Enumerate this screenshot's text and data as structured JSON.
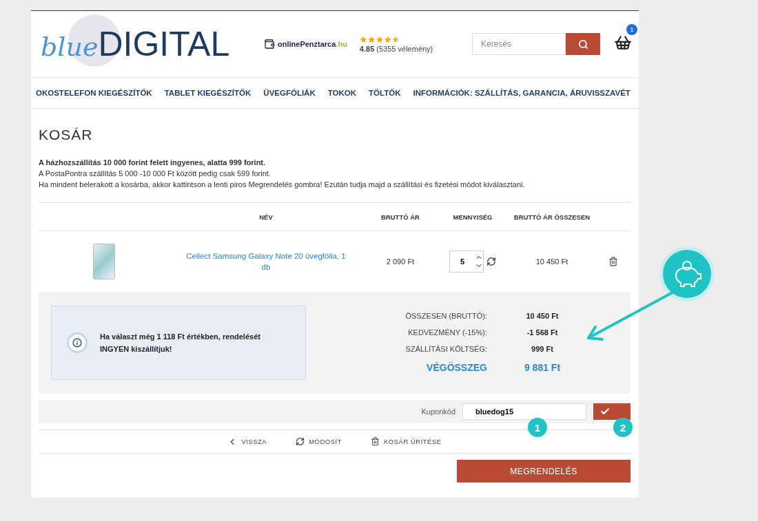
{
  "header": {
    "logo": {
      "part_1": "blue",
      "part_2": "DIGITAL"
    },
    "partner": {
      "name": "onlinePenztarca",
      "domain": ".hu"
    },
    "rating": {
      "stars": 4.5,
      "score": "4.85",
      "reviews": "(5355 vélemény)"
    },
    "search": {
      "placeholder": "Keresés"
    },
    "cart_count": "1"
  },
  "nav": [
    "OKOSTELEFON KIEGÉSZÍTŐK",
    "TABLET KIEGÉSZÍTŐK",
    "ÜVEGFÓLIÁK",
    "TOKOK",
    "TÖLTŐK",
    "INFORMÁCIÓK: SZÁLLÍTÁS, GARANCIA, ÁRUVISSZAVÉT"
  ],
  "page_title": "KOSÁR",
  "info": [
    "A házhozszállítás 10 000 forint felett ingyenes, alatta 999 forint.",
    "A PostaPontra szállítás 5 000 -10 000 Ft között pedig csak 599 forint.",
    "Ha mindent belerakott a kosárba, akkor kattintson a lenti piros Megrendelés gombra! Ezután tudja majd a szállítási és fizetési módot kiválasztani."
  ],
  "table": {
    "columns": [
      "NÉV",
      "BRUTTÓ ÁR",
      "MENNYISÉG",
      "BRUTTÓ ÁR ÖSSZESEN"
    ],
    "rows": [
      {
        "name": "Cellect Samsung Galaxy Note 20 üvegfólia, 1 db",
        "price": "2 090 Ft",
        "quantity": "5",
        "total": "10 450 Ft"
      }
    ]
  },
  "notice": "Ha választ még 1 118 Ft értékben, rendelését INGYEN kiszállítjuk!",
  "summary": [
    {
      "label": "ÖSSZESEN (BRUTTÓ):",
      "value": "10 450 Ft",
      "kind": "normal"
    },
    {
      "label": "KEDVEZMÉNY (-15%):",
      "value": "-1 568 Ft",
      "kind": "normal"
    },
    {
      "label": "SZÁLLÍTÁSI KÖLTSÉG:",
      "value": "999 Ft",
      "kind": "normal"
    },
    {
      "label": "VÉGÖSSZEG",
      "value": "9 881 Ft",
      "kind": "total"
    }
  ],
  "coupon": {
    "label": "Kuponkód",
    "value": "bluedog15"
  },
  "badges": [
    "1",
    "2"
  ],
  "actions": [
    "VISSZA",
    "MÓDOSÍT",
    "KOSÁR ÜRÍTÉSE"
  ],
  "order_button": "MEGRENDELÉS"
}
